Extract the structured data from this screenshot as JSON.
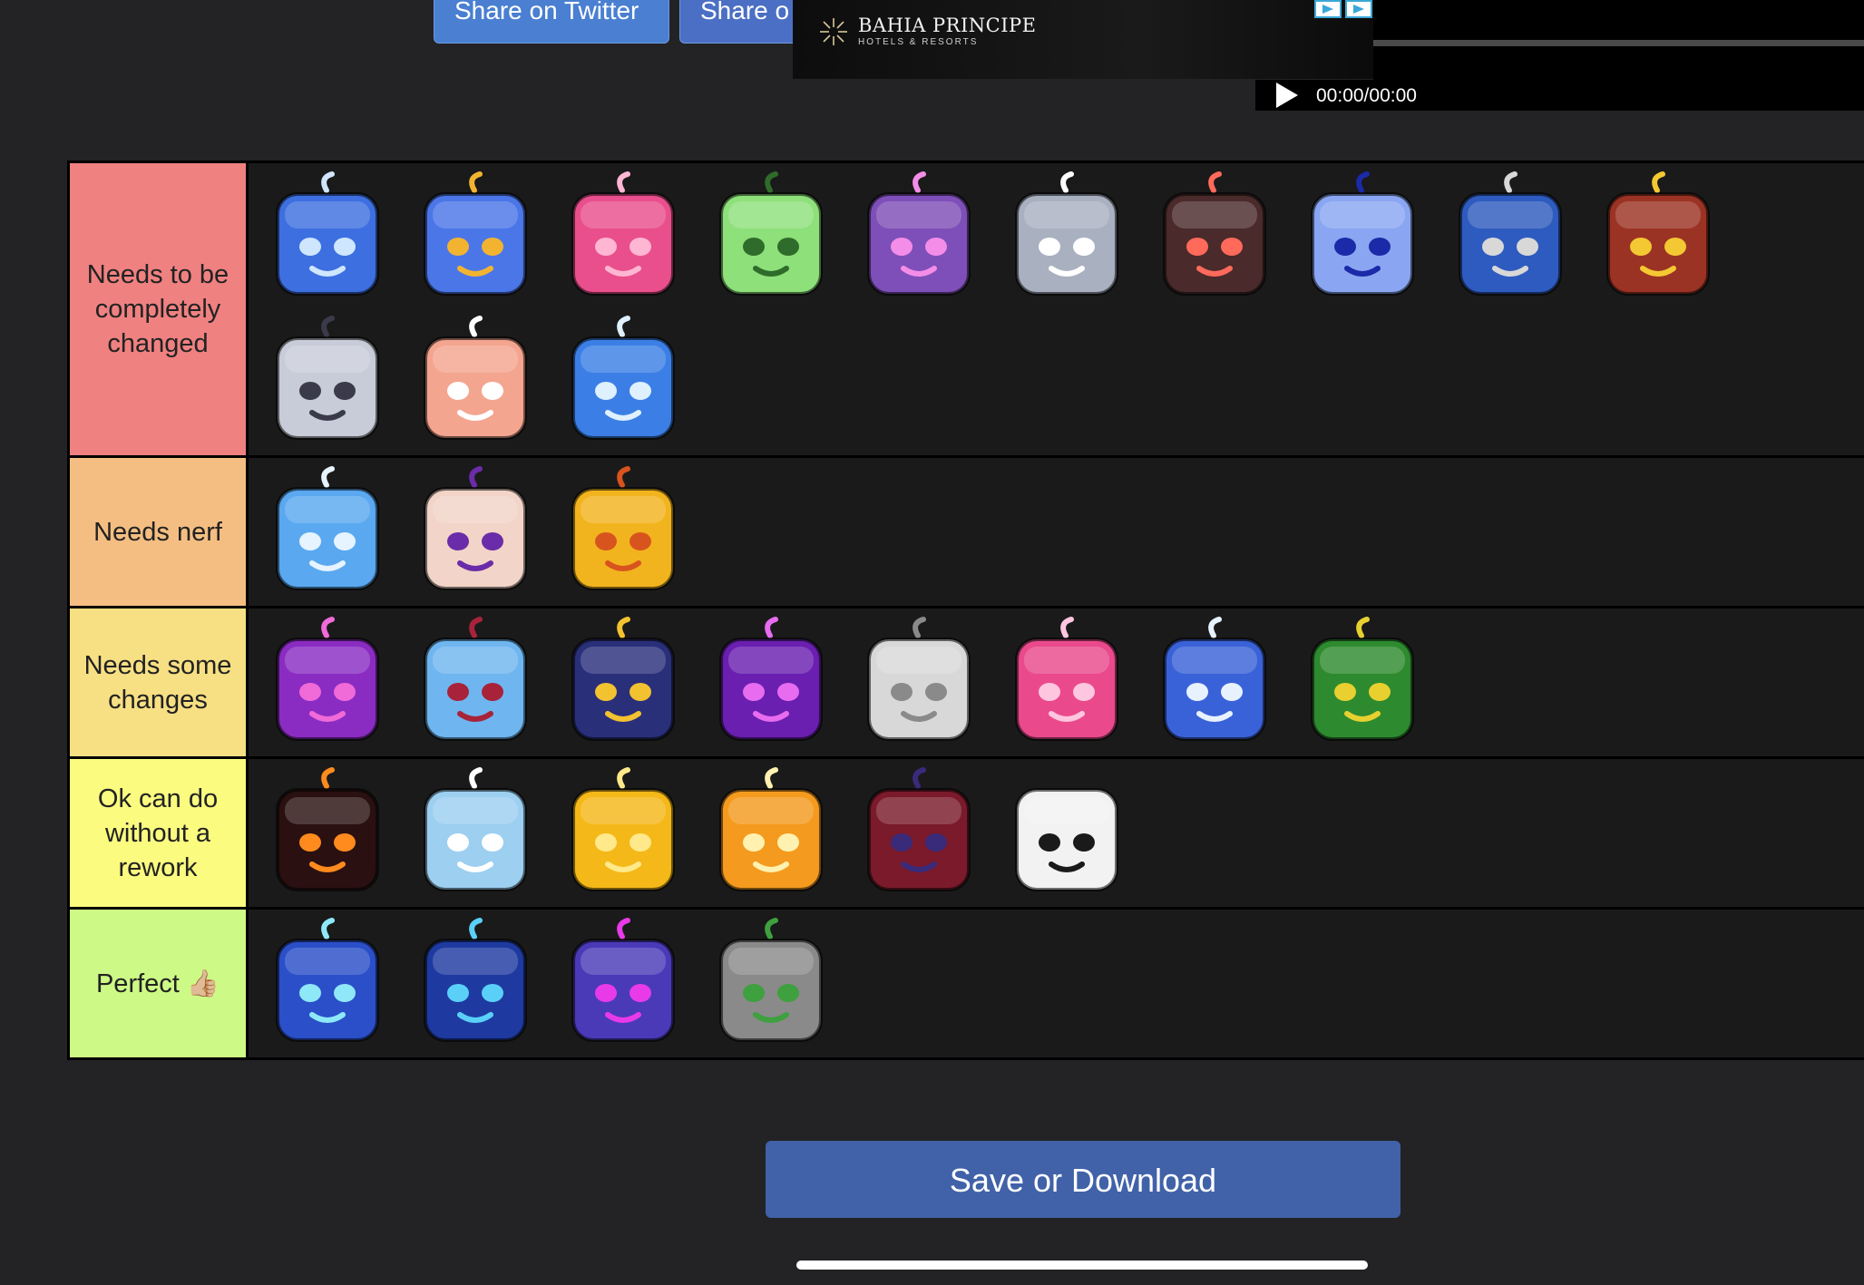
{
  "share": {
    "twitter_label": "Share on Twitter",
    "other_label": "Share o"
  },
  "ad": {
    "brand": "BAHIA PRINCIPE",
    "subtitle": "HOTELS & RESORTS",
    "video_time": "00:00/00:00"
  },
  "tiers": [
    {
      "label": "Needs to be completely changed",
      "color": "#f08181",
      "fruits": [
        {
          "icon": "cloud-face-fruit-icon",
          "color": "#3d6fe0",
          "accent": "#cfe6ff"
        },
        {
          "icon": "dragon-crown-fruit-icon",
          "color": "#4b76e8",
          "accent": "#f2b430"
        },
        {
          "icon": "pink-face-fruit-icon",
          "color": "#e94f8c",
          "accent": "#ffb6d3"
        },
        {
          "icon": "green-smile-fruit-icon",
          "color": "#8ee07a",
          "accent": "#2f6b2a"
        },
        {
          "icon": "planet-ring-fruit-icon",
          "color": "#7e4fb8",
          "accent": "#f48de8"
        },
        {
          "icon": "grey-wolf-fruit-icon",
          "color": "#a9b0c0",
          "accent": "#ffffff"
        },
        {
          "icon": "dark-bomb-fruit-icon",
          "color": "#4a2a2a",
          "accent": "#ff6a5b"
        },
        {
          "icon": "fluffy-cloud-fruit-icon",
          "color": "#8aa6f2",
          "accent": "#1b2aa8"
        },
        {
          "icon": "blue-spiral-fruit-icon",
          "color": "#2e5bbf",
          "accent": "#d8d8d8"
        },
        {
          "icon": "bird-wing-fruit-icon",
          "color": "#9b3324",
          "accent": "#f4c832"
        },
        {
          "icon": "white-stone-fruit-icon",
          "color": "#c8ccd8",
          "accent": "#3a3a4a"
        },
        {
          "icon": "bandage-pink-fruit-icon",
          "color": "#f4a58f",
          "accent": "#ffffff"
        },
        {
          "icon": "crystal-blue-fruit-icon",
          "color": "#3b7fe6",
          "accent": "#dff0ff"
        }
      ]
    },
    {
      "label": "Needs nerf",
      "color": "#f4be82",
      "fruits": [
        {
          "icon": "ice-horn-fruit-icon",
          "color": "#5aa8f0",
          "accent": "#e6f4ff"
        },
        {
          "icon": "dough-skull-fruit-icon",
          "color": "#f2d4c8",
          "accent": "#6a2ca8"
        },
        {
          "icon": "leopard-fruit-icon",
          "color": "#f2b41e",
          "accent": "#d8541e"
        }
      ]
    },
    {
      "label": "Needs some changes",
      "color": "#f7df83",
      "fruits": [
        {
          "icon": "bat-wing-fruit-icon",
          "color": "#8a2cc2",
          "accent": "#f06ad8"
        },
        {
          "icon": "mask-split-fruit-icon",
          "color": "#6fb6f0",
          "accent": "#a8233a"
        },
        {
          "icon": "mammoth-fruit-icon",
          "color": "#2a2f7a",
          "accent": "#f2c230"
        },
        {
          "icon": "purple-shadow-fruit-icon",
          "color": "#6a1fb0",
          "accent": "#e86cf0"
        },
        {
          "icon": "mummy-wrap-fruit-icon",
          "color": "#d8d8d8",
          "accent": "#8a8a8a"
        },
        {
          "icon": "pink-heart-fruit-icon",
          "color": "#ea4a8c",
          "accent": "#ffc6e0"
        },
        {
          "icon": "lightning-crack-fruit-icon",
          "color": "#3a62d8",
          "accent": "#e8f2ff"
        },
        {
          "icon": "green-horn-fruit-icon",
          "color": "#2e8a2e",
          "accent": "#e8d030"
        }
      ]
    },
    {
      "label": "Ok can do without a rework",
      "color": "#fbfb80",
      "fruits": [
        {
          "icon": "magma-fruit-icon",
          "color": "#2a1010",
          "accent": "#ff8a1e"
        },
        {
          "icon": "snow-fruit-icon",
          "color": "#9ccff0",
          "accent": "#ffffff"
        },
        {
          "icon": "golden-light-fruit-icon",
          "color": "#f4b818",
          "accent": "#ffe98a"
        },
        {
          "icon": "orange-star-fruit-icon",
          "color": "#f49a1e",
          "accent": "#fff2b0"
        },
        {
          "icon": "demon-dark-fruit-icon",
          "color": "#7a1a2a",
          "accent": "#3a2a7a"
        },
        {
          "icon": "ghost-fruit-icon",
          "color": "#f2f2f2",
          "accent": "#1a1a1a"
        }
      ]
    },
    {
      "label": "Perfect 👍🏼",
      "color": "#cdf986",
      "fruits": [
        {
          "icon": "spiral-blue-fruit-icon",
          "color": "#2a4fc8",
          "accent": "#8fe8f8"
        },
        {
          "icon": "blue-flame-fruit-icon",
          "color": "#1e3aa0",
          "accent": "#5ad0f8"
        },
        {
          "icon": "purple-eye-fruit-icon",
          "color": "#4a3ab8",
          "accent": "#e83ae8"
        },
        {
          "icon": "grey-dragon-fruit-icon",
          "color": "#8a8a8a",
          "accent": "#3ea03e"
        }
      ]
    }
  ],
  "save_button_label": "Save or Download"
}
